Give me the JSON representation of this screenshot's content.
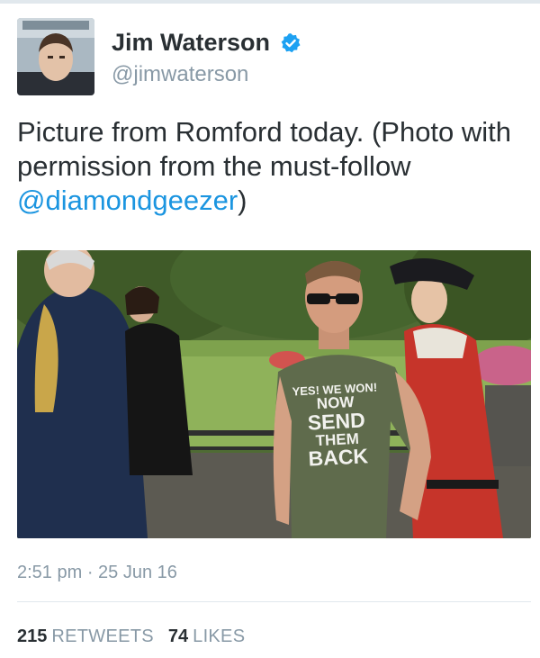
{
  "tweet": {
    "display_name": "Jim Waterson",
    "handle": "@jimwaterson",
    "verified_icon": "verified-badge-icon",
    "text_before_mention": "Picture from Romford today. (Photo with permission from the must-follow ",
    "mention": "@diamondgeezer",
    "text_after_mention": ")",
    "photo_shirt_lines": [
      "YES! WE WON!",
      "NOW",
      "SEND",
      "THEM",
      "BACK"
    ],
    "timestamp": "2:51 pm · 25 Jun 16",
    "retweets_count": "215",
    "retweets_label": "RETWEETS",
    "likes_count": "74",
    "likes_label": "LIKES"
  },
  "colors": {
    "link": "#1b95e0",
    "verified": "#1da1f2",
    "text": "#292f33",
    "muted": "#8899a6"
  }
}
